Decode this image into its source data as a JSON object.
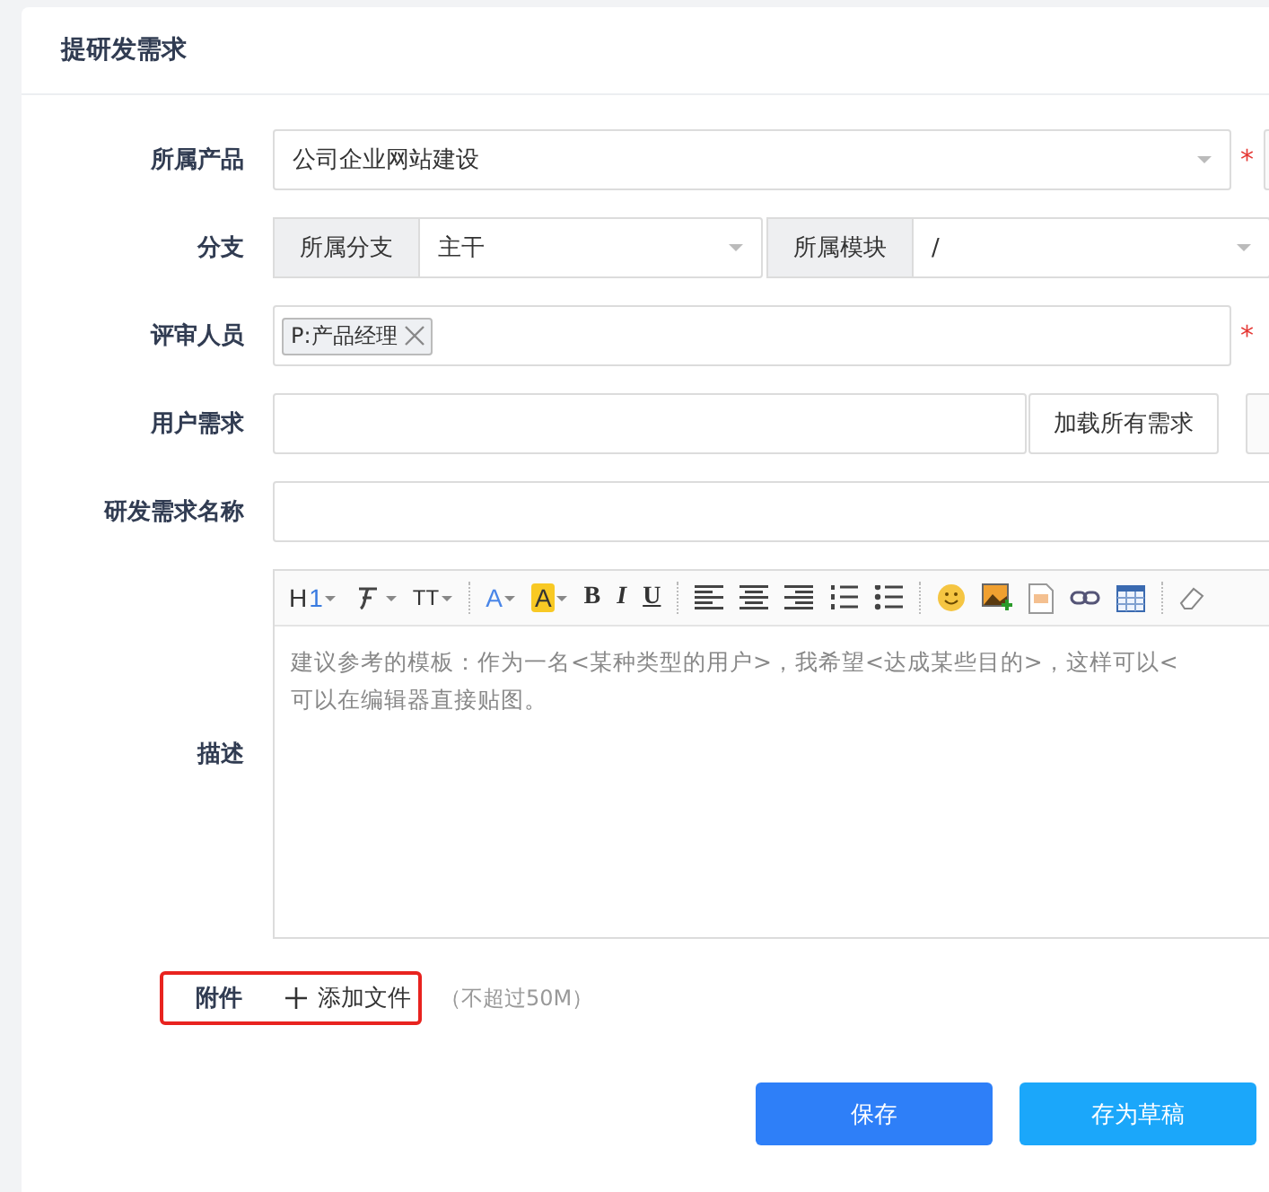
{
  "title": "提研发需求",
  "product": {
    "label": "所属产品",
    "value": "公司企业网站建设",
    "required_mark": "*"
  },
  "branch": {
    "label": "分支",
    "branch_addon": "所属分支",
    "branch_value": "主干",
    "module_addon": "所属模块",
    "module_value": "/"
  },
  "reviewers": {
    "label": "评审人员",
    "tags": [
      "P:产品经理"
    ],
    "required_mark": "*"
  },
  "user_story": {
    "label": "用户需求",
    "button": "加载所有需求"
  },
  "name": {
    "label": "研发需求名称"
  },
  "description": {
    "label": "描述",
    "toolbar": [
      {
        "kind": "heading",
        "label": "H",
        "sub": "1"
      },
      {
        "kind": "font"
      },
      {
        "kind": "size",
        "label": "TT"
      },
      {
        "kind": "sep"
      },
      {
        "kind": "forecolor",
        "label": "A"
      },
      {
        "kind": "backcolor",
        "label": "A"
      },
      {
        "kind": "bold",
        "label": "B"
      },
      {
        "kind": "italic",
        "label": "I"
      },
      {
        "kind": "underline",
        "label": "U"
      },
      {
        "kind": "sep"
      },
      {
        "kind": "align-left"
      },
      {
        "kind": "align-center"
      },
      {
        "kind": "align-right"
      },
      {
        "kind": "ordered-list"
      },
      {
        "kind": "bullet-list"
      },
      {
        "kind": "sep"
      },
      {
        "kind": "emoji"
      },
      {
        "kind": "image"
      },
      {
        "kind": "code"
      },
      {
        "kind": "link"
      },
      {
        "kind": "table"
      },
      {
        "kind": "sep"
      },
      {
        "kind": "eraser"
      }
    ],
    "placeholder": "建议参考的模板：作为一名<某种类型的用户>，我希望<达成某些目的>，这样可以<\n可以在编辑器直接贴图。"
  },
  "attachment": {
    "label": "附件",
    "add": "添加文件",
    "hint": "（不超过50M）"
  },
  "buttons": [
    {
      "kind": "primary",
      "label": "保存"
    },
    {
      "kind": "secondary",
      "label": "存为草稿"
    }
  ]
}
